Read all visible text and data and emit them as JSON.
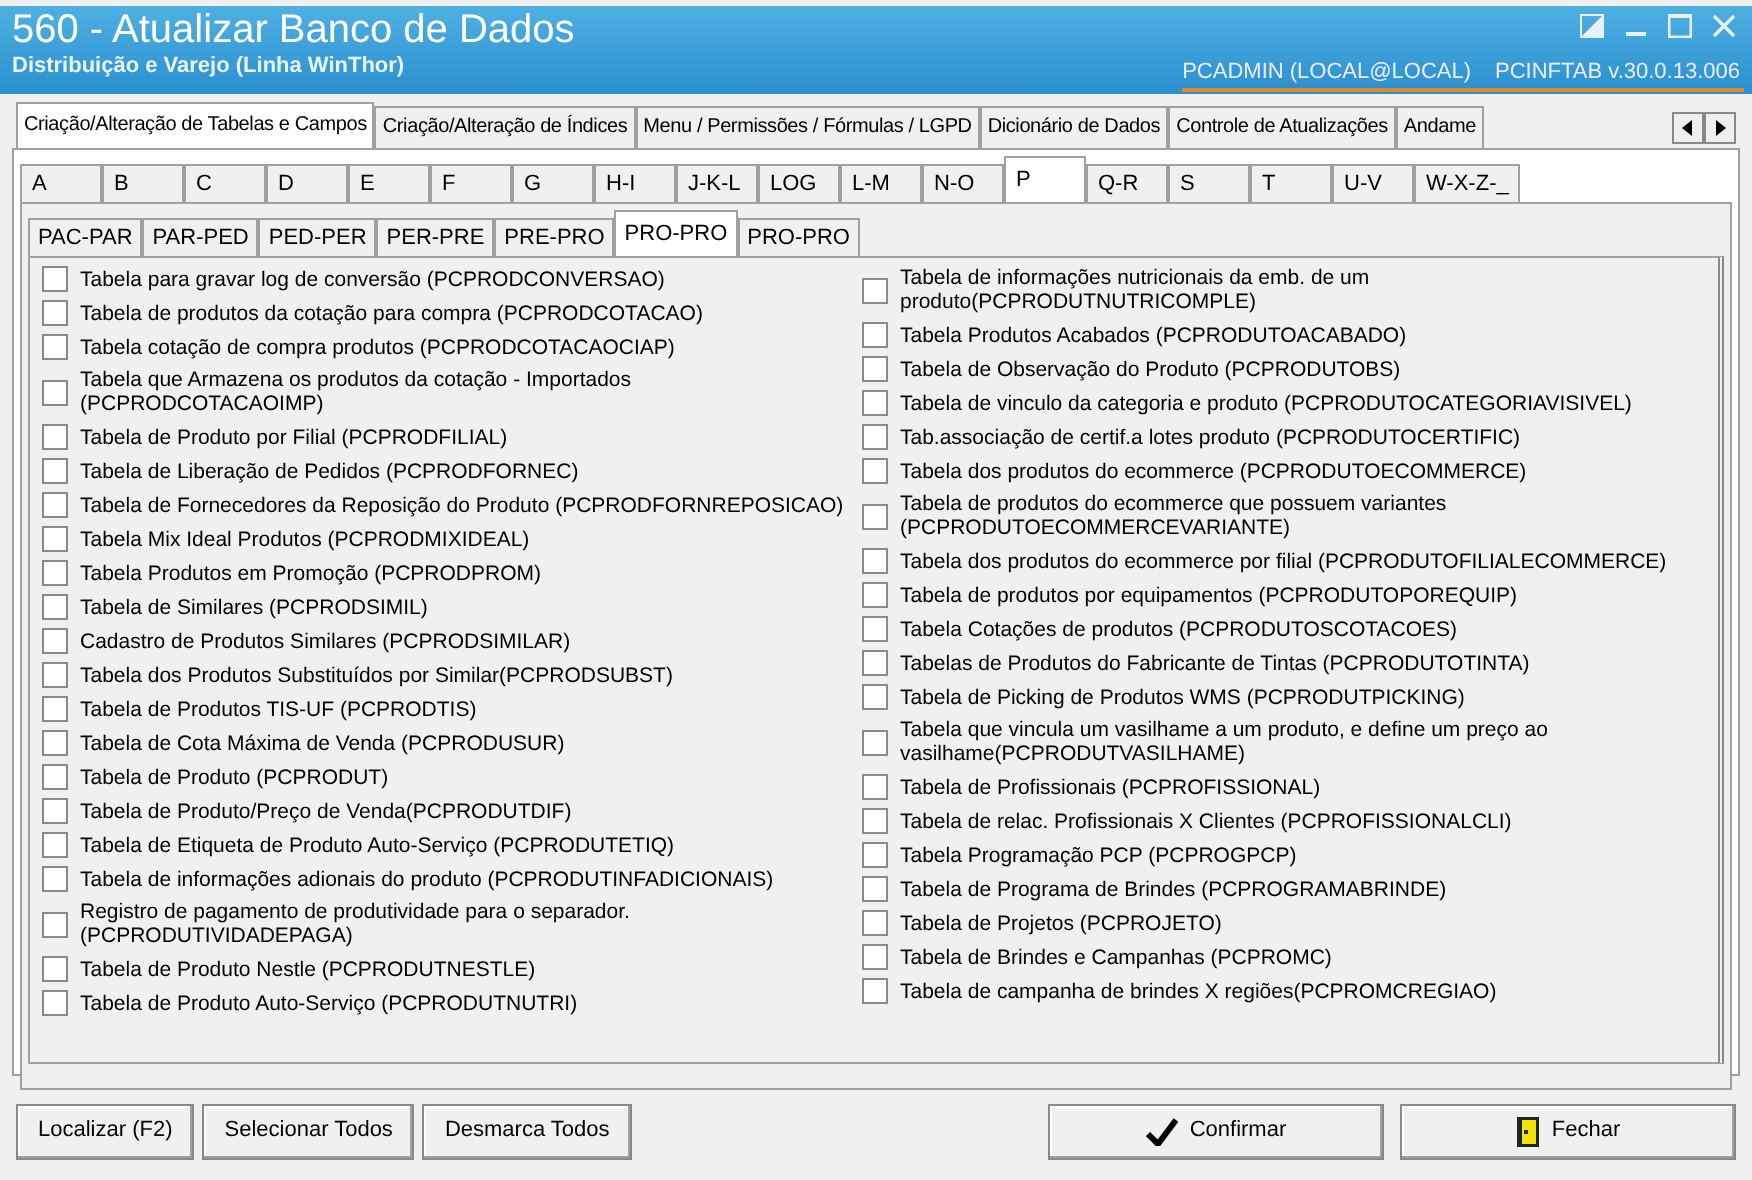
{
  "window": {
    "title": "560 - Atualizar Banco de Dados",
    "subtitle": "Distribuição e Varejo (Linha WinThor)",
    "user": "PCADMIN (LOCAL@LOCAL)",
    "version": "PCINFTAB  v.30.0.13.006"
  },
  "main_tabs": [
    {
      "label": "Criação/Alteração de Tabelas e Campos",
      "selected": true
    },
    {
      "label": "Criação/Alteração de Índices",
      "selected": false
    },
    {
      "label": "Menu / Permissões / Fórmulas / LGPD",
      "selected": false
    },
    {
      "label": "Dicionário de Dados",
      "selected": false
    },
    {
      "label": "Controle de Atualizações",
      "selected": false
    },
    {
      "label": "Andame",
      "selected": false
    }
  ],
  "letter_tabs": [
    {
      "label": "A",
      "selected": false
    },
    {
      "label": "B",
      "selected": false
    },
    {
      "label": "C",
      "selected": false
    },
    {
      "label": "D",
      "selected": false
    },
    {
      "label": "E",
      "selected": false
    },
    {
      "label": "F",
      "selected": false
    },
    {
      "label": "G",
      "selected": false
    },
    {
      "label": "H-I",
      "selected": false
    },
    {
      "label": "J-K-L",
      "selected": false
    },
    {
      "label": "LOG",
      "selected": false
    },
    {
      "label": "L-M",
      "selected": false
    },
    {
      "label": "N-O",
      "selected": false
    },
    {
      "label": "P",
      "selected": true
    },
    {
      "label": "Q-R",
      "selected": false
    },
    {
      "label": "S",
      "selected": false
    },
    {
      "label": "T",
      "selected": false
    },
    {
      "label": "U-V",
      "selected": false
    },
    {
      "label": "W-X-Z-_",
      "selected": false
    }
  ],
  "sub_tabs": [
    {
      "label": "PAC-PAR",
      "selected": false
    },
    {
      "label": "PAR-PED",
      "selected": false
    },
    {
      "label": "PED-PER",
      "selected": false
    },
    {
      "label": "PER-PRE",
      "selected": false
    },
    {
      "label": "PRE-PRO",
      "selected": false
    },
    {
      "label": "PRO-PRO",
      "selected": true
    },
    {
      "label": "PRO-PRO",
      "selected": false
    }
  ],
  "left_tables": [
    {
      "label": "Tabela para gravar log de conversão (PCPRODCONVERSAO)",
      "checked": false
    },
    {
      "label": "Tabela de produtos da cotação para compra (PCPRODCOTACAO)",
      "checked": false
    },
    {
      "label": "Tabela cotação de compra produtos (PCPRODCOTACAOCIAP)",
      "checked": false
    },
    {
      "label": "Tabela que Armazena os produtos da cotação - Importados (PCPRODCOTACAOIMP)",
      "checked": false
    },
    {
      "label": "Tabela de Produto por Filial (PCPRODFILIAL)",
      "checked": false
    },
    {
      "label": "Tabela de Liberação de Pedidos (PCPRODFORNEC)",
      "checked": false
    },
    {
      "label": "Tabela de Fornecedores da Reposição do Produto (PCPRODFORNREPOSICAO)",
      "checked": false
    },
    {
      "label": "Tabela Mix Ideal Produtos (PCPRODMIXIDEAL)",
      "checked": false
    },
    {
      "label": "Tabela Produtos em Promoção (PCPRODPROM)",
      "checked": false
    },
    {
      "label": "Tabela de Similares (PCPRODSIMIL)",
      "checked": false
    },
    {
      "label": "Cadastro de Produtos Similares (PCPRODSIMILAR)",
      "checked": false
    },
    {
      "label": "Tabela dos Produtos Substituídos por Similar(PCPRODSUBST)",
      "checked": false
    },
    {
      "label": "Tabela de Produtos TIS-UF (PCPRODTIS)",
      "checked": false
    },
    {
      "label": "Tabela de Cota Máxima de Venda (PCPRODUSUR)",
      "checked": false
    },
    {
      "label": "Tabela de Produto (PCPRODUT)",
      "checked": false
    },
    {
      "label": "Tabela de Produto/Preço de Venda(PCPRODUTDIF)",
      "checked": false
    },
    {
      "label": "Tabela de Etiqueta de Produto Auto-Serviço (PCPRODUTETIQ)",
      "checked": false
    },
    {
      "label": "Tabela de informações adionais do produto (PCPRODUTINFADICIONAIS)",
      "checked": false
    },
    {
      "label": "Registro de pagamento de produtividade para o separador.(PCPRODUTIVIDADEPAGA)",
      "checked": false
    },
    {
      "label": "Tabela de Produto Nestle (PCPRODUTNESTLE)",
      "checked": false
    },
    {
      "label": "Tabela de Produto Auto-Serviço (PCPRODUTNUTRI)",
      "checked": false
    }
  ],
  "right_tables": [
    {
      "label": "Tabela de informações nutricionais da emb. de um produto(PCPRODUTNUTRICOMPLE)",
      "checked": false
    },
    {
      "label": "Tabela Produtos Acabados (PCPRODUTOACABADO)",
      "checked": false
    },
    {
      "label": "Tabela de Observação do Produto (PCPRODUTOBS)",
      "checked": false
    },
    {
      "label": "Tabela de vinculo da categoria e produto (PCPRODUTOCATEGORIAVISIVEL)",
      "checked": false
    },
    {
      "label": "Tab.associação de certif.a lotes produto (PCPRODUTOCERTIFIC)",
      "checked": false
    },
    {
      "label": "Tabela dos produtos do ecommerce (PCPRODUTOECOMMERCE)",
      "checked": false
    },
    {
      "label": "Tabela de produtos do ecommerce que possuem variantes (PCPRODUTOECOMMERCEVARIANTE)",
      "checked": false
    },
    {
      "label": "Tabela dos produtos do ecommerce por filial (PCPRODUTOFILIALECOMMERCE)",
      "checked": false
    },
    {
      "label": "Tabela de produtos por equipamentos (PCPRODUTOPOREQUIP)",
      "checked": false
    },
    {
      "label": "Tabela Cotações de produtos (PCPRODUTOSCOTACOES)",
      "checked": false
    },
    {
      "label": "Tabelas de Produtos do Fabricante de Tintas (PCPRODUTOTINTA)",
      "checked": false
    },
    {
      "label": "Tabela de Picking de Produtos WMS (PCPRODUTPICKING)",
      "checked": false
    },
    {
      "label": "Tabela que vincula um vasilhame a um produto, e define um preço ao vasilhame(PCPRODUTVASILHAME)",
      "checked": false
    },
    {
      "label": "Tabela de Profissionais (PCPROFISSIONAL)",
      "checked": false
    },
    {
      "label": "Tabela de relac. Profissionais X Clientes (PCPROFISSIONALCLI)",
      "checked": false
    },
    {
      "label": "Tabela Programação PCP (PCPROGPCP)",
      "checked": false
    },
    {
      "label": "Tabela de Programa de Brindes (PCPROGRAMABRINDE)",
      "checked": false
    },
    {
      "label": "Tabela de Projetos (PCPROJETO)",
      "checked": false
    },
    {
      "label": "Tabela de Brindes e Campanhas  (PCPROMC)",
      "checked": false
    },
    {
      "label": "Tabela de campanha de brindes X regiões(PCPROMCREGIAO)",
      "checked": false
    }
  ],
  "left_buttons": [
    {
      "label": "Localizar (F2)"
    },
    {
      "label": "Selecionar Todos"
    },
    {
      "label": "Desmarca Todos"
    }
  ],
  "right_buttons": [
    {
      "label": "Confirmar",
      "kind": "confirm"
    },
    {
      "label": "Fechar",
      "kind": "close"
    }
  ]
}
